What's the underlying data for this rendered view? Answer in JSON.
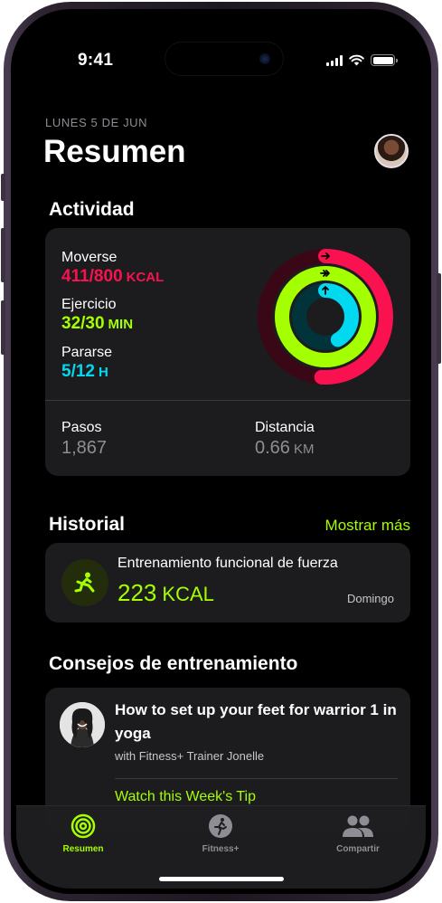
{
  "status_bar": {
    "time": "9:41"
  },
  "header": {
    "date": "LUNES 5 DE JUN",
    "title": "Resumen"
  },
  "activity": {
    "section_title": "Actividad",
    "move": {
      "label": "Moverse",
      "value": "411/800",
      "unit": "KCAL",
      "progress": 0.51
    },
    "exercise": {
      "label": "Ejercicio",
      "value": "32/30",
      "unit": "MIN",
      "progress": 1.07
    },
    "stand": {
      "label": "Pararse",
      "value": "5/12",
      "unit": "H",
      "progress": 0.42
    },
    "steps": {
      "label": "Pasos",
      "value": "1,867"
    },
    "distance": {
      "label": "Distancia",
      "value": "0.66",
      "unit": "KM"
    },
    "colors": {
      "move": "#fa114f",
      "exercise": "#a4ff00",
      "stand": "#00d9f0"
    }
  },
  "history": {
    "section_title": "Historial",
    "show_more": "Mostrar más",
    "workout": {
      "title": "Entrenamiento funcional de fuerza",
      "value": "223",
      "unit": "KCAL",
      "day": "Domingo"
    }
  },
  "tips": {
    "section_title": "Consejos de entrenamiento",
    "title": "How to set up your feet for warrior 1 in yoga",
    "subtitle": "with Fitness+ Trainer Jonelle",
    "link": "Watch this Week's Tip"
  },
  "tabs": [
    {
      "label": "Resumen",
      "icon": "activity-rings-icon",
      "active": true
    },
    {
      "label": "Fitness+",
      "icon": "runner-icon",
      "active": false
    },
    {
      "label": "Compartir",
      "icon": "people-icon",
      "active": false
    }
  ]
}
